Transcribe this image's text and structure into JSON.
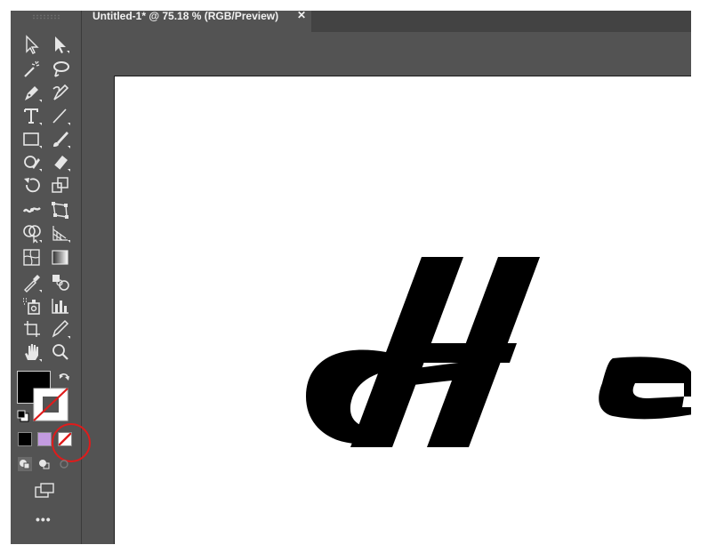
{
  "document": {
    "tab_title": "Untitled-1* @ 75.18 % (RGB/Preview)",
    "close_glyph": "✕",
    "artboard_text": "He"
  },
  "toolbar": {
    "tools": [
      "selection-tool",
      "direct-selection-tool",
      "magic-wand-tool",
      "lasso-tool",
      "pen-tool",
      "curvature-tool",
      "type-tool",
      "line-segment-tool",
      "rectangle-tool",
      "paintbrush-tool",
      "shaper-tool",
      "eraser-tool",
      "rotate-tool",
      "scale-tool",
      "width-tool",
      "free-transform-tool",
      "shape-builder-tool",
      "perspective-grid-tool",
      "mesh-tool",
      "gradient-tool",
      "eyedropper-tool",
      "blend-tool",
      "symbol-sprayer-tool",
      "column-graph-tool",
      "artboard-tool",
      "slice-tool",
      "hand-tool",
      "zoom-tool"
    ],
    "more_label": "•••"
  },
  "colors": {
    "fill": "#000000",
    "stroke": "none",
    "gradient_swatch": "#c39be0",
    "annotation": "#e01b1b"
  }
}
